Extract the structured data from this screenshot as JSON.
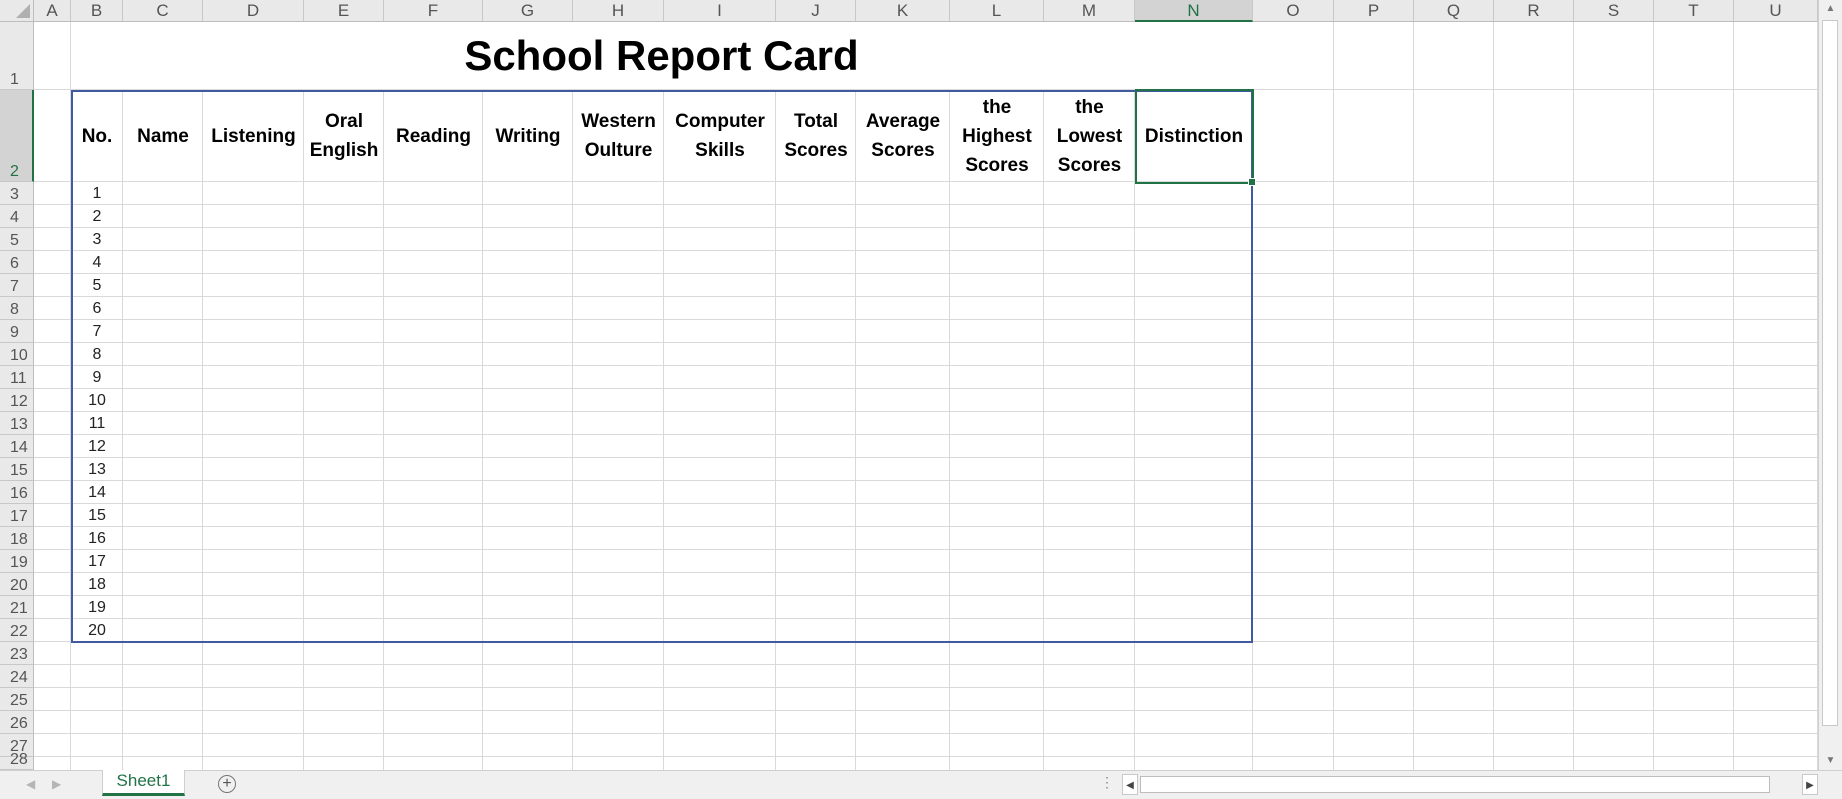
{
  "columns": [
    "A",
    "B",
    "C",
    "D",
    "E",
    "F",
    "G",
    "H",
    "I",
    "J",
    "K",
    "L",
    "M",
    "N",
    "O",
    "P",
    "Q",
    "R",
    "S",
    "T",
    "U"
  ],
  "selected_column": "N",
  "rows": [
    "1",
    "2",
    "3",
    "4",
    "5",
    "6",
    "7",
    "8",
    "9",
    "10",
    "11",
    "12",
    "13",
    "14",
    "15",
    "16",
    "17",
    "18",
    "19",
    "20",
    "21",
    "22",
    "23",
    "24",
    "25",
    "26",
    "27",
    "28"
  ],
  "selected_row": "2",
  "sheet": {
    "title": "School Report Card",
    "headers": [
      [
        "No."
      ],
      [
        "Name"
      ],
      [
        "Listening"
      ],
      [
        "Oral",
        "English"
      ],
      [
        "Reading"
      ],
      [
        "Writing"
      ],
      [
        "Western",
        "Oulture"
      ],
      [
        "Computer",
        "Skills"
      ],
      [
        "Total",
        "Scores"
      ],
      [
        "Average",
        "Scores"
      ],
      [
        "the",
        "Highest",
        "Scores"
      ],
      [
        "the",
        "Lowest",
        "Scores"
      ],
      [
        "Distinction"
      ]
    ],
    "numbers": [
      "1",
      "2",
      "3",
      "4",
      "5",
      "6",
      "7",
      "8",
      "9",
      "10",
      "11",
      "12",
      "13",
      "14",
      "15",
      "16",
      "17",
      "18",
      "19",
      "20"
    ]
  },
  "tabs": {
    "active_sheet": "Sheet1",
    "add_icon": "plus-circle-icon"
  },
  "colors": {
    "table_border": "#3f5a9e",
    "selection": "#217346",
    "header_bg": "#e9e9e9"
  }
}
